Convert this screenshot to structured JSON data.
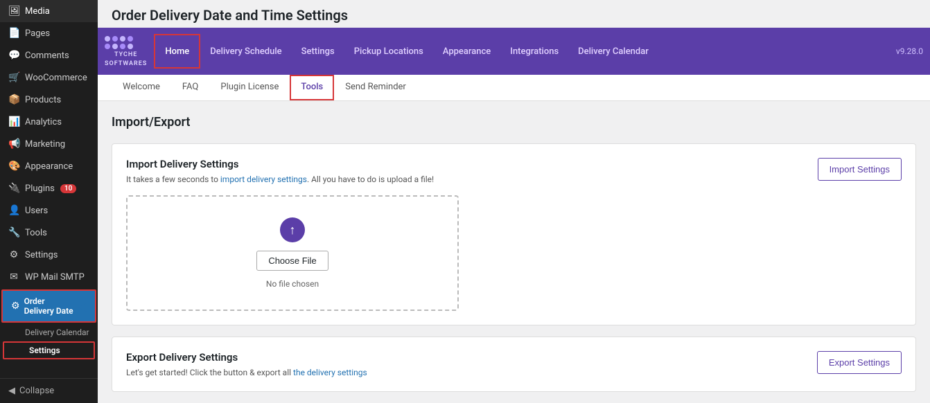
{
  "page": {
    "title": "Order Delivery Date and Time Settings"
  },
  "sidebar": {
    "items": [
      {
        "id": "media",
        "label": "Media",
        "icon": "🖼"
      },
      {
        "id": "pages",
        "label": "Pages",
        "icon": "📄"
      },
      {
        "id": "comments",
        "label": "Comments",
        "icon": "💬"
      },
      {
        "id": "woocommerce",
        "label": "WooCommerce",
        "icon": "🛒"
      },
      {
        "id": "products",
        "label": "Products",
        "icon": "📦"
      },
      {
        "id": "analytics",
        "label": "Analytics",
        "icon": "📊"
      },
      {
        "id": "marketing",
        "label": "Marketing",
        "icon": "📢"
      },
      {
        "id": "appearance",
        "label": "Appearance",
        "icon": "🎨"
      },
      {
        "id": "plugins",
        "label": "Plugins",
        "icon": "🔌",
        "badge": "10"
      },
      {
        "id": "users",
        "label": "Users",
        "icon": "👤"
      },
      {
        "id": "tools",
        "label": "Tools",
        "icon": "🔧"
      },
      {
        "id": "settings",
        "label": "Settings",
        "icon": "⚙"
      },
      {
        "id": "wp-mail-smtp",
        "label": "WP Mail SMTP",
        "icon": "✉"
      }
    ],
    "order_delivery": {
      "label": "Order Delivery Date",
      "icon": "⚙"
    },
    "sub_items": [
      {
        "id": "delivery-calendar",
        "label": "Delivery Calendar"
      },
      {
        "id": "settings-sub",
        "label": "Settings",
        "active": true
      }
    ],
    "collapse_label": "Collapse"
  },
  "plugin_nav": {
    "logo": {
      "brand": "TYCHE",
      "sub": "SOFTWARES"
    },
    "items": [
      {
        "id": "home",
        "label": "Home",
        "active_highlight": true
      },
      {
        "id": "delivery-schedule",
        "label": "Delivery Schedule"
      },
      {
        "id": "settings",
        "label": "Settings"
      },
      {
        "id": "pickup-locations",
        "label": "Pickup Locations"
      },
      {
        "id": "appearance",
        "label": "Appearance"
      },
      {
        "id": "integrations",
        "label": "Integrations"
      },
      {
        "id": "delivery-calendar",
        "label": "Delivery Calendar"
      }
    ],
    "version": "v9.28.0"
  },
  "sub_tabs": {
    "items": [
      {
        "id": "welcome",
        "label": "Welcome"
      },
      {
        "id": "faq",
        "label": "FAQ"
      },
      {
        "id": "plugin-license",
        "label": "Plugin License"
      },
      {
        "id": "tools",
        "label": "Tools",
        "active": true,
        "highlight": true
      },
      {
        "id": "send-reminder",
        "label": "Send Reminder"
      }
    ]
  },
  "content": {
    "section_title": "Import/Export",
    "import_card": {
      "title": "Import Delivery Settings",
      "description": "It takes a few seconds to import delivery settings. All you have to do is upload a file!",
      "button_label": "Import Settings",
      "upload": {
        "choose_file_label": "Choose File",
        "no_file_label": "No file chosen"
      }
    },
    "export_card": {
      "title": "Export Delivery Settings",
      "description": "Let's get started! Click the button & export all the delivery settings",
      "button_label": "Export Settings"
    }
  }
}
